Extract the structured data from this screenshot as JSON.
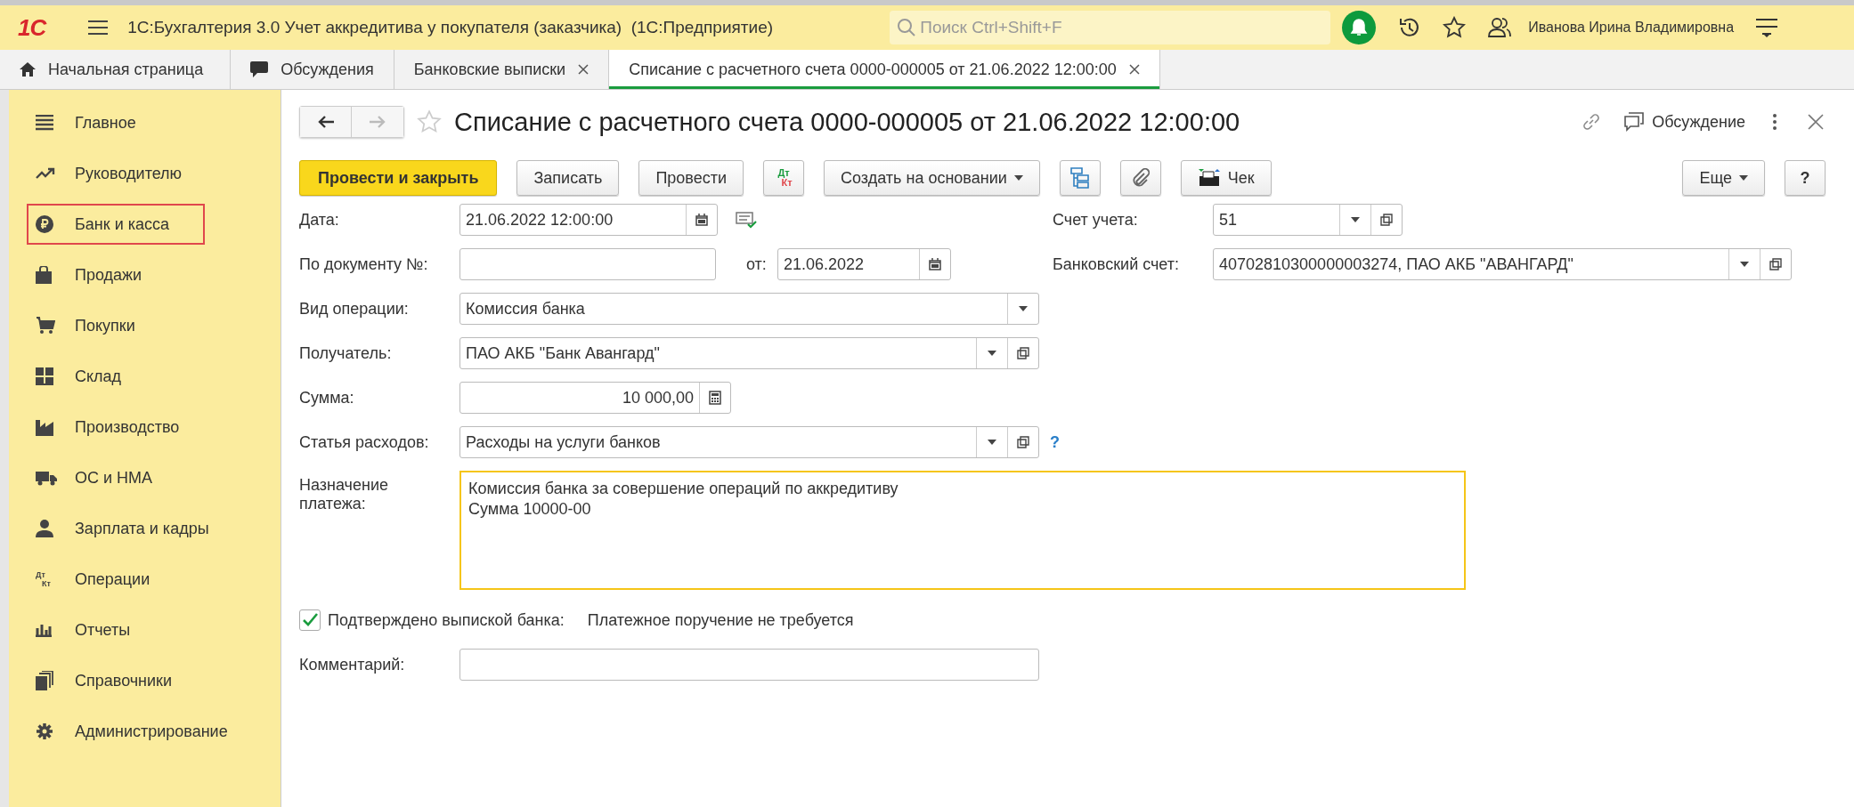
{
  "window": {
    "logo": "1С",
    "title": "1С:Бухгалтерия 3.0 Учет аккредитива у покупателя (заказчика)  (1С:Предприятие)",
    "search": {
      "placeholder": "Поиск Ctrl+Shift+F"
    },
    "user": "Иванова Ирина Владимировна"
  },
  "tabs": [
    {
      "label": "Начальная страница",
      "kind": "home",
      "closable": false,
      "selected": false
    },
    {
      "label": "Обсуждения",
      "kind": "chat",
      "closable": false,
      "selected": false
    },
    {
      "label": "Банковские выписки",
      "kind": "plain",
      "closable": true,
      "selected": false
    },
    {
      "label": "Списание с расчетного счета 0000-000005 от 21.06.2022 12:00:00",
      "kind": "plain",
      "closable": true,
      "selected": true
    }
  ],
  "sidebar": {
    "items": [
      {
        "label": "Главное",
        "kind": "lines",
        "highlighted": false
      },
      {
        "label": "Руководителю",
        "kind": "trend",
        "highlighted": false
      },
      {
        "label": "Банк и касса",
        "kind": "ruble",
        "highlighted": true
      },
      {
        "label": "Продажи",
        "kind": "bag",
        "highlighted": false
      },
      {
        "label": "Покупки",
        "kind": "cart",
        "highlighted": false
      },
      {
        "label": "Склад",
        "kind": "grid",
        "highlighted": false
      },
      {
        "label": "Производство",
        "kind": "factory",
        "highlighted": false
      },
      {
        "label": "ОС и НМА",
        "kind": "truck",
        "highlighted": false
      },
      {
        "label": "Зарплата и кадры",
        "kind": "person",
        "highlighted": false
      },
      {
        "label": "Операции",
        "kind": "dtkt",
        "icon_top": "Дт",
        "icon_bottom": "Кт",
        "highlighted": false
      },
      {
        "label": "Отчеты",
        "kind": "bars",
        "highlighted": false
      },
      {
        "label": "Справочники",
        "kind": "books",
        "highlighted": false
      },
      {
        "label": "Администрирование",
        "kind": "gear",
        "highlighted": false
      }
    ]
  },
  "document": {
    "title": "Списание с расчетного счета 0000-000005 от 21.06.2022 12:00:00",
    "discussion": "Обсуждение",
    "toolbar": [
      {
        "kind": "primary",
        "label": "Провести и закрыть"
      },
      {
        "kind": "button",
        "label": "Записать"
      },
      {
        "kind": "button",
        "label": "Провести"
      },
      {
        "kind": "dtkt",
        "top": "Дт",
        "bottom": "Кт"
      },
      {
        "kind": "dropdown",
        "label": "Создать на основании"
      },
      {
        "kind": "structure"
      },
      {
        "kind": "clip"
      },
      {
        "kind": "printer",
        "label": "Чек"
      }
    ],
    "toolbar_right": [
      {
        "kind": "dropdown",
        "label": "Еще"
      },
      {
        "kind": "button",
        "label": "?"
      }
    ]
  },
  "form": {
    "date": {
      "label": "Дата:",
      "value": "21.06.2022 12:00:00",
      "calendar": true
    },
    "doc_number": {
      "label": "По документу №:"
    },
    "doc_date": {
      "label": "от:",
      "value": "21.06.2022",
      "calendar": true
    },
    "account": {
      "label": "Счет учета:",
      "value": "51",
      "dropdown": true,
      "open_button": true
    },
    "bank_account": {
      "label": "Банковский счет:",
      "value": "40702810300000003274, ПАО АКБ \"АВАНГАРД\"",
      "dropdown": true,
      "open_button": true
    },
    "operation": {
      "label": "Вид операции:",
      "value": "Комиссия банка",
      "dropdown": true
    },
    "recipient": {
      "label": "Получатель:",
      "value": "ПАО АКБ \"Банк Авангард\"",
      "dropdown": true,
      "open_button": true
    },
    "amount": {
      "label": "Сумма:",
      "value": "10 000,00",
      "calculator": true
    },
    "expense_item": {
      "label": "Статья расходов:",
      "value": "Расходы на услуги банков",
      "dropdown": true,
      "open_button": true,
      "help": "?"
    },
    "purpose": {
      "label": "Назначение платежа:",
      "lines": [
        "Комиссия банка за совершение операций по аккредитиву",
        "Сумма 10000-00"
      ],
      "focused": true
    },
    "confirmed": {
      "label": "Подтверждено выпиской банка:",
      "checked": true
    },
    "payment_note": "Платежное поручение не требуется",
    "comment": {
      "label": "Комментарий:"
    }
  }
}
